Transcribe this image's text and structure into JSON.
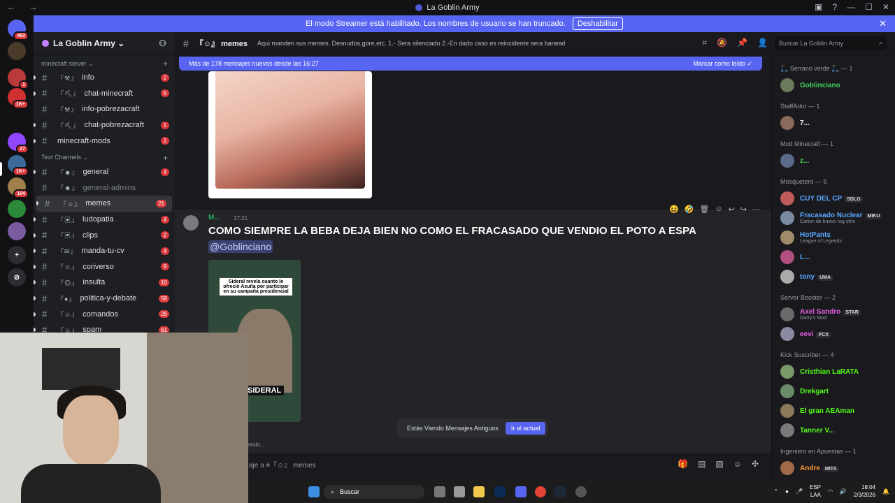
{
  "window": {
    "title": "La Goblin Army"
  },
  "banner": {
    "text": "El modo Streamer está habilitado. Los nombres de usuario se han truncado.",
    "button": "Deshabilitar"
  },
  "servers": [
    {
      "badge": "463",
      "color": "#5865f2"
    },
    {
      "badge": "",
      "color": "#4a3a2a"
    },
    {
      "badge": "1",
      "color": "#b83a3a"
    },
    {
      "badge": "1K+",
      "color": "#d03030"
    },
    {
      "badge": "27",
      "color": "#9146ff"
    },
    {
      "badge": "1K+",
      "color": "#3a6a9a"
    },
    {
      "badge": "104",
      "color": "#a0804a"
    },
    {
      "badge": "",
      "color": "#2a8a3a"
    },
    {
      "badge": "",
      "color": "#7a5aa0"
    }
  ],
  "sidebar": {
    "guild_name": "La Goblin Army",
    "categories": [
      {
        "name": "minecraft server",
        "channels": [
          {
            "name": "info",
            "prefix": "『⚒』",
            "count": "2",
            "state": "normal"
          },
          {
            "name": "chat-minecraft",
            "prefix": "『⛏』",
            "count": "5",
            "state": "normal"
          },
          {
            "name": "info-pobrezacraft",
            "prefix": "『⚒』",
            "count": "",
            "state": "normal"
          },
          {
            "name": "chat-pobrezacraft",
            "prefix": "『⛏』",
            "count": "1",
            "state": "normal"
          },
          {
            "name": "minecraft-mods",
            "prefix": "",
            "count": "1",
            "state": "normal"
          }
        ]
      },
      {
        "name": "Text Channels",
        "channels": [
          {
            "name": "general",
            "prefix": "『☻』",
            "count": "4",
            "state": "normal"
          },
          {
            "name": "general-admins",
            "prefix": "『☻』",
            "count": "",
            "state": "muted"
          },
          {
            "name": "memes",
            "prefix": "『☺』",
            "count": "21",
            "state": "active"
          },
          {
            "name": "ludopatia",
            "prefix": "『▣』",
            "count": "4",
            "state": "normal"
          },
          {
            "name": "clips",
            "prefix": "『▣』",
            "count": "2",
            "state": "normal"
          },
          {
            "name": "manda-tu-cv",
            "prefix": "『✉』",
            "count": "4",
            "state": "normal"
          },
          {
            "name": "coriverso",
            "prefix": "『☺』",
            "count": "9",
            "state": "normal"
          },
          {
            "name": "insulta",
            "prefix": "『☹』",
            "count": "10",
            "state": "normal"
          },
          {
            "name": "politica-y-debate",
            "prefix": "『●』",
            "count": "58",
            "state": "normal"
          },
          {
            "name": "comandos",
            "prefix": "『☺』",
            "count": "26",
            "state": "normal"
          },
          {
            "name": "spam",
            "prefix": "『☺』",
            "count": "61",
            "state": "normal"
          }
        ]
      }
    ]
  },
  "header": {
    "channel": "memes",
    "prefix": "『☺』",
    "topic": "Aqui manden sus memes. Desnudos,gore,etc. 1.- Sera silenciado 2.-En dado caso es reincidente sera baneado",
    "search_placeholder": "Buscar La Goblin Army"
  },
  "chat": {
    "new_messages": "Más de 178 mensajes nuevos desde las 16:27",
    "mark_read": "Marcar como leído",
    "message": {
      "author": "M...",
      "time": "17:21",
      "text": "COMO SIEMPRE LA BEBA DEJA BIEN NO COMO EL FRACASADO QUE VENDIO EL POTO A ESPA",
      "mention": "@Goblinciano",
      "video_caption": "Sideral revela cuanto le ofreció Acuña por participar en su campaña presidencial",
      "video_label": "SIDERAL"
    },
    "old_messages": "Estás Viendo Mensajes Antiguos",
    "jump_button": "Ir al actual",
    "typing": "ando...",
    "composer_placeholder": "aje a #『☺』 memes"
  },
  "members": {
    "groups": [
      {
        "title": "🛴 Serrano verde 🛴 — 1",
        "members": [
          {
            "name": "Goblinciano",
            "sub": "",
            "tag": "",
            "color": "#3fd15a"
          }
        ]
      },
      {
        "title": "StaffAdor — 1",
        "members": [
          {
            "name": "7...",
            "sub": "",
            "tag": "",
            "color": "#f2f3f5"
          }
        ]
      },
      {
        "title": "Mod Minecraft — 1",
        "members": [
          {
            "name": "z...",
            "sub": "",
            "tag": "",
            "color": "#3fd15a"
          }
        ]
      },
      {
        "title": "Mosquetero — 5",
        "members": [
          {
            "name": "CUY DEL CP",
            "sub": "",
            "tag": "SDLG",
            "color": "#5aa7ff"
          },
          {
            "name": "Fracasado Nuclear",
            "sub": "Carton de huevo rog strix",
            "tag": "MIKU",
            "color": "#5aa7ff"
          },
          {
            "name": "HotPants",
            "sub": "League of Legends",
            "tag": "",
            "color": "#5aa7ff"
          },
          {
            "name": "L...",
            "sub": "",
            "tag": "",
            "color": "#5aa7ff"
          },
          {
            "name": "tony",
            "sub": "",
            "tag": "UMA",
            "color": "#5aa7ff"
          }
        ]
      },
      {
        "title": "Server Booster — 2",
        "members": [
          {
            "name": "Axel Sandro",
            "sub": "Garry's Mod",
            "tag": "STAR",
            "color": "#e35de3"
          },
          {
            "name": "eevi",
            "sub": "",
            "tag": "PCX",
            "color": "#e35de3"
          }
        ]
      },
      {
        "title": "Kick Suscriber — 4",
        "members": [
          {
            "name": "Cristhian LaRATA",
            "sub": "",
            "tag": "",
            "color": "#53fc18"
          },
          {
            "name": "Drekgart",
            "sub": "",
            "tag": "",
            "color": "#53fc18"
          },
          {
            "name": "El gran AEAman",
            "sub": "",
            "tag": "",
            "color": "#53fc18"
          },
          {
            "name": "Tanner V...",
            "sub": "",
            "tag": "",
            "color": "#53fc18"
          }
        ]
      },
      {
        "title": "Ingeniero en Apuestas — 1",
        "members": [
          {
            "name": "Andre",
            "sub": "",
            "tag": "MITA",
            "color": "#ff9a3c"
          }
        ]
      }
    ]
  },
  "taskbar": {
    "search": "Buscar",
    "lang": "ESP",
    "lang2": "LAA",
    "time": "18:04",
    "date": "2/3/2026"
  }
}
